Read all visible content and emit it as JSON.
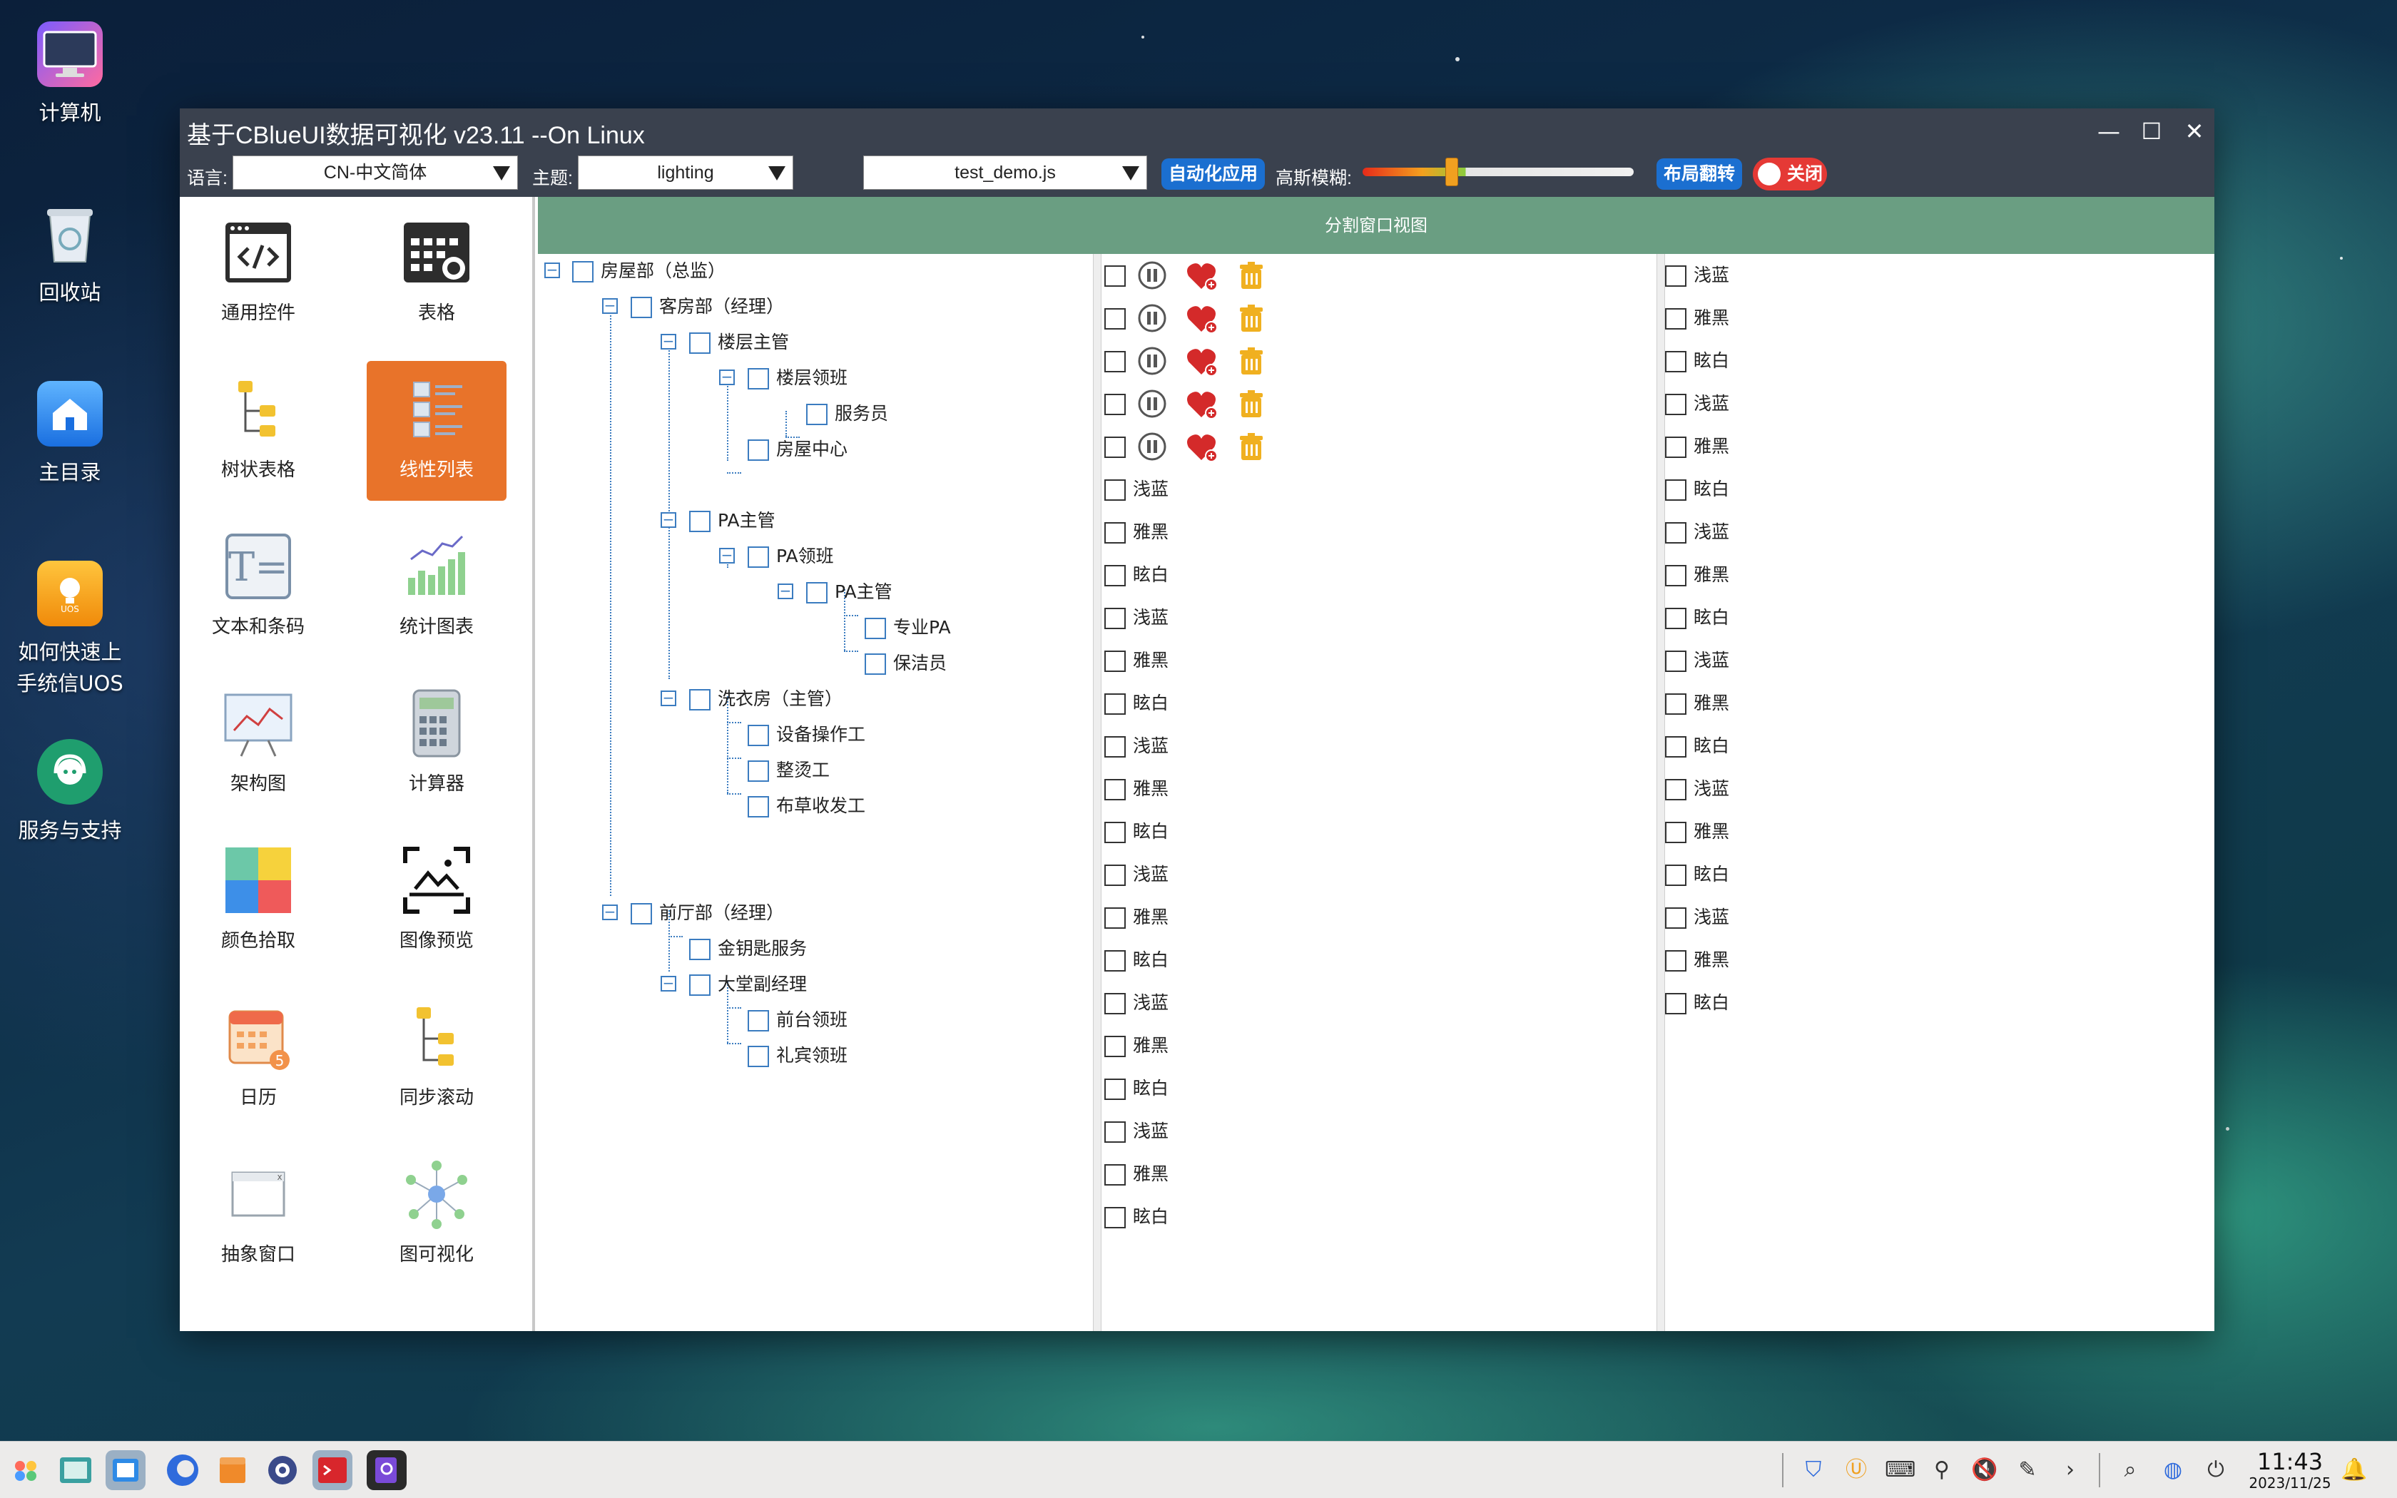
{
  "desktop": {
    "icons": [
      {
        "label": "计算机"
      },
      {
        "label": "回收站"
      },
      {
        "label": "主目录"
      },
      {
        "label": "如何快速上\n手统信UOS"
      },
      {
        "label": "服务与支持"
      }
    ]
  },
  "window": {
    "title": "基于CBlueUI数据可视化 v23.11 --On Linux",
    "controls": {
      "minimize": "—",
      "maximize": "☐",
      "close": "✕"
    }
  },
  "toolbar": {
    "lang_label": "语言:",
    "lang_value": "CN-中文简体",
    "theme_label": "主题:",
    "theme_value": "lighting",
    "script_value": "test_demo.js",
    "auto_app_btn": "自动化应用",
    "blur_label": "高斯模糊:",
    "blur_level": 0.33,
    "flip_btn": "布局翻转",
    "toggle_label": "关闭"
  },
  "sidebar": {
    "tiles": [
      {
        "label": "通用控件",
        "icon": "code-icon"
      },
      {
        "label": "表格",
        "icon": "table-settings-icon"
      },
      {
        "label": "树状表格",
        "icon": "tree-icon"
      },
      {
        "label": "线性列表",
        "icon": "list-icon",
        "active": true
      },
      {
        "label": "文本和条码",
        "icon": "text-icon"
      },
      {
        "label": "统计图表",
        "icon": "chart-icon"
      },
      {
        "label": "架构图",
        "icon": "board-icon"
      },
      {
        "label": "计算器",
        "icon": "calculator-icon"
      },
      {
        "label": "颜色拾取",
        "icon": "color-picker-icon"
      },
      {
        "label": "图像预览",
        "icon": "image-preview-icon"
      },
      {
        "label": "日历",
        "icon": "calendar-icon"
      },
      {
        "label": "同步滚动",
        "icon": "sync-scroll-icon"
      },
      {
        "label": "抽象窗口",
        "icon": "window-icon"
      },
      {
        "label": "图可视化",
        "icon": "graph-icon"
      }
    ]
  },
  "content": {
    "header": "分割窗口视图",
    "tree": [
      {
        "label": "房屋部（总监）"
      },
      {
        "label": "客房部（经理）"
      },
      {
        "label": "楼层主管"
      },
      {
        "label": "楼层领班"
      },
      {
        "label": "服务员"
      },
      {
        "label": "房屋中心"
      },
      {
        "label": "PA主管"
      },
      {
        "label": "PA领班"
      },
      {
        "label": "PA主管"
      },
      {
        "label": "专业PA"
      },
      {
        "label": "保洁员"
      },
      {
        "label": "洗衣房（主管）"
      },
      {
        "label": "设备操作工"
      },
      {
        "label": "整烫工"
      },
      {
        "label": "布草收发工"
      },
      {
        "label": "前厅部（经理）"
      },
      {
        "label": "金钥匙服务"
      },
      {
        "label": "大堂副经理"
      },
      {
        "label": "前台领班"
      },
      {
        "label": "礼宾领班"
      }
    ],
    "middle_list": [
      "浅蓝",
      "雅黑",
      "眩白",
      "浅蓝",
      "雅黑",
      "眩白",
      "浅蓝",
      "雅黑",
      "眩白",
      "浅蓝",
      "雅黑",
      "眩白",
      "浅蓝",
      "雅黑",
      "眩白",
      "浅蓝",
      "雅黑",
      "眩白"
    ],
    "right_list": [
      "浅蓝",
      "雅黑",
      "眩白",
      "浅蓝",
      "雅黑",
      "眩白",
      "浅蓝",
      "雅黑",
      "眩白",
      "浅蓝",
      "雅黑",
      "眩白",
      "浅蓝",
      "雅黑",
      "眩白",
      "浅蓝",
      "雅黑",
      "眩白"
    ]
  },
  "taskbar": {
    "apps": [
      "launcher-icon",
      "file-manager-icon",
      "app-store-icon",
      "browser-icon",
      "package-icon",
      "settings-icon",
      "terminal-icon",
      "search-app-icon"
    ],
    "tray": [
      "shield-icon",
      "u-icon",
      "keyboard-icon",
      "usb-icon",
      "volume-mute-icon",
      "pen-icon",
      "chevron-right-icon",
      "search-icon",
      "network-icon",
      "power-icon"
    ],
    "time": "11:43",
    "date": "2023/11/25"
  },
  "colors": {
    "titlebar": "#3a414e",
    "accent_btn": "#1b6fd0",
    "active_tile": "#e8732a",
    "header_bar": "#6a9e82",
    "toggle_red": "#e53935"
  }
}
